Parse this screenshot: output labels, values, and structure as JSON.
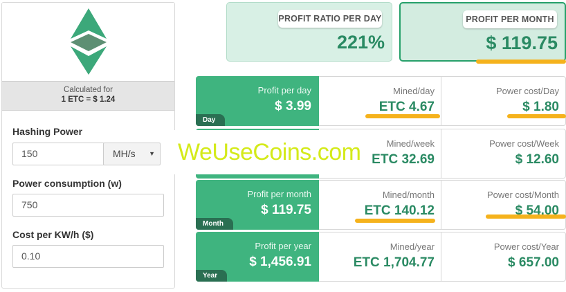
{
  "calculated_for": {
    "label": "Calculated for",
    "value": "1 ETC = $ 1.24"
  },
  "form": {
    "hashing_power": {
      "label": "Hashing Power",
      "value": "150",
      "unit": "MH/s"
    },
    "power_consumption": {
      "label": "Power consumption (w)",
      "value": "750"
    },
    "cost_per_kwh": {
      "label": "Cost per KW/h ($)",
      "value": "0.10"
    }
  },
  "summary": {
    "profit_ratio": {
      "label": "PROFIT RATIO PER DAY",
      "value": "221%"
    },
    "profit_month": {
      "label": "PROFIT PER MONTH",
      "value": "$ 119.75"
    }
  },
  "rows": [
    {
      "tag": "Day",
      "profit_label": "Profit per day",
      "profit_value": "$ 3.99",
      "mined_label": "Mined/day",
      "mined_value": "ETC 4.67",
      "power_label": "Power cost/Day",
      "power_value": "$ 1.80"
    },
    {
      "tag": "",
      "profit_label": "",
      "profit_value": "",
      "mined_label": "Mined/week",
      "mined_value": "ETC 32.69",
      "power_label": "Power cost/Week",
      "power_value": "$ 12.60"
    },
    {
      "tag": "Month",
      "profit_label": "Profit per month",
      "profit_value": "$ 119.75",
      "mined_label": "Mined/month",
      "mined_value": "ETC 140.12",
      "power_label": "Power cost/Month",
      "power_value": "$ 54.00"
    },
    {
      "tag": "Year",
      "profit_label": "Profit per year",
      "profit_value": "$ 1,456.91",
      "mined_label": "Mined/year",
      "mined_value": "ETC 1,704.77",
      "power_label": "Power cost/Year",
      "power_value": "$ 657.00"
    }
  ],
  "watermark": "WeUseCoins.com",
  "icons": {
    "logo": "ethereum-classic-logo-icon",
    "caret": "caret-down-icon"
  },
  "colors": {
    "accent_green": "#3fb47f",
    "dark_green": "#2a6f52",
    "value_green": "#2a8a63",
    "highlight_orange": "#f5b21c",
    "watermark_yellow": "#d4ea1a"
  }
}
